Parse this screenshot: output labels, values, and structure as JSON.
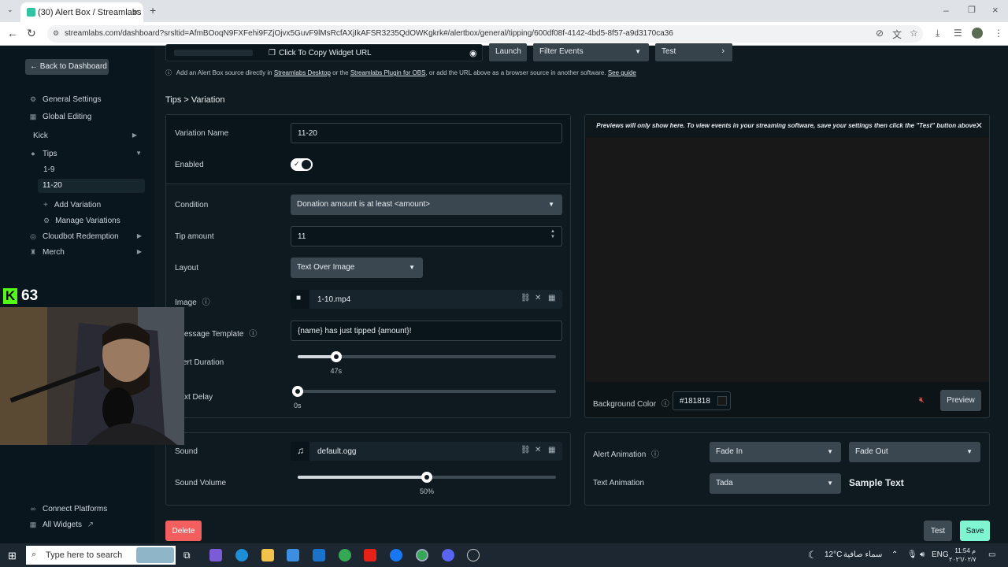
{
  "browser": {
    "tab_title": "(30) Alert Box / Streamlabs",
    "url": "streamlabs.com/dashboard?srsltid=AfmBOoqN9FXFehi9FZjOjvx5GuvF9lMsRcfAXjIkAFSR3235QdOWKgkrk#/alertbox/general/tipping/600df08f-4142-4bd5-8f57-a9d3170ca36"
  },
  "sidebar": {
    "back_label": "Back to Dashboard",
    "general_settings": "General Settings",
    "global_editing": "Global Editing",
    "kick": "Kick",
    "tips": "Tips",
    "variation_1": "1-9",
    "variation_2": "11-20",
    "add_variation": "Add Variation",
    "manage_variations": "Manage Variations",
    "cloudbot": "Cloudbot Redemption",
    "merch": "Merch",
    "connect_platforms": "Connect Platforms",
    "all_widgets": "All Widgets"
  },
  "toolbar": {
    "copy_url_label": "Click To Copy Widget URL",
    "launch_label": "Launch",
    "filter_label": "Filter Events",
    "test_label": "Test"
  },
  "info": {
    "prefix": "Add an Alert Box source directly in",
    "link1": "Streamlabs Desktop",
    "mid": "or the",
    "link2": "Streamlabs Plugin for OBS",
    "suffix": ", or add the URL above as a browser source in another software.",
    "link3": "See guide"
  },
  "breadcrumb": "Tips > Variation",
  "form": {
    "variation_name_label": "Variation Name",
    "variation_name_value": "11-20",
    "enabled_label": "Enabled",
    "condition_label": "Condition",
    "condition_value": "Donation amount is at least <amount>",
    "tip_amount_label": "Tip amount",
    "tip_amount_value": "11",
    "layout_label": "Layout",
    "layout_value": "Text Over Image",
    "image_label": "Image",
    "image_file": "1-10.mp4",
    "message_template_label": "essage Template",
    "message_template_value": "{name} has just tipped {amount}!",
    "alert_duration_label": "ert Duration",
    "alert_duration_value": "47s",
    "alert_duration_fraction": 0.15,
    "text_delay_label": "xt Delay",
    "text_delay_value": "0s",
    "text_delay_fraction": 0.0,
    "sound_label": "Sound",
    "sound_file": "default.ogg",
    "sound_volume_label": "Sound Volume",
    "sound_volume_value": "50%",
    "sound_volume_fraction": 0.5
  },
  "preview": {
    "note": "Previews will only show here. To view events in your streaming software, save your settings then click the \"Test\" button above.",
    "background_color_label": "Background Color",
    "background_color_value": "#181818",
    "preview_button": "Preview"
  },
  "animation": {
    "alert_animation_label": "Alert Animation",
    "alert_in": "Fade In",
    "alert_out": "Fade Out",
    "text_animation_label": "Text Animation",
    "text_anim": "Tada",
    "sample_text": "Sample Text"
  },
  "footer": {
    "delete_label": "Delete",
    "test_label": "Test",
    "save_label": "Save"
  },
  "overlay": {
    "kick_count": "63"
  },
  "taskbar": {
    "search_placeholder": "Type here to search",
    "weather": "12°C",
    "weather_text": "سماء صافية",
    "lang": "ENG",
    "time": "11:54 م",
    "date": "٢٠٢٦/٠٢/٧"
  },
  "colors": {
    "accent_green": "#80f5d2",
    "delete_red": "#f35f5f",
    "kick_green": "#53fc18"
  }
}
